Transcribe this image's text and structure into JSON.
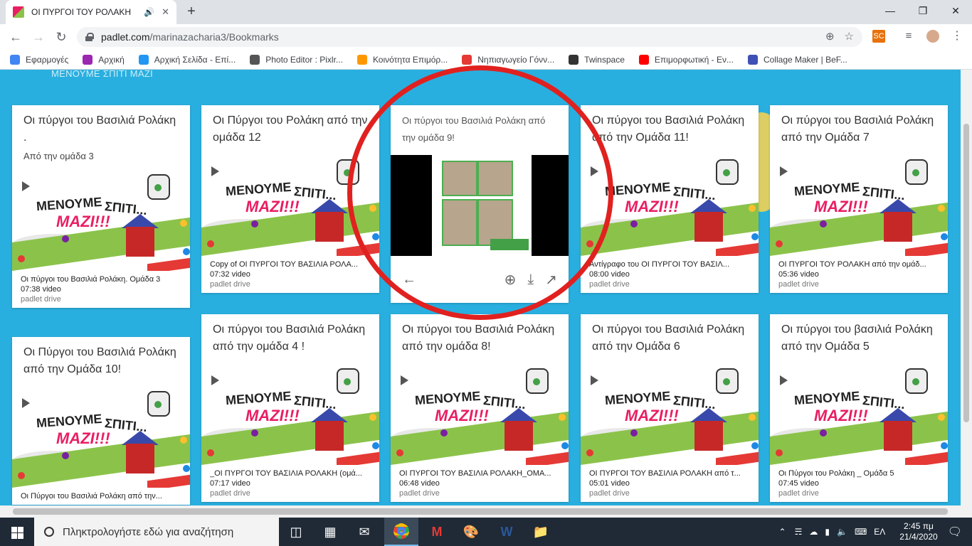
{
  "browser": {
    "tab_title": "ΟΙ ΠΥΡΓΟΙ ΤΟΥ ΡΟΛΑΚΗ",
    "url_domain": "padlet.com",
    "url_path": "/marinazacharia3/Bookmarks",
    "extension_badge": "SC"
  },
  "bookmarks": [
    {
      "label": "Εφαρμογές",
      "icon": "apps-grid-icon",
      "color": "#4285f4"
    },
    {
      "label": "Αρχική",
      "icon": "arrow-icon",
      "color": "#9c27b0"
    },
    {
      "label": "Αρχική Σελίδα - Επί...",
      "icon": "globe-icon",
      "color": "#2196f3"
    },
    {
      "label": "Photo Editor : Pixlr...",
      "icon": "aperture-icon",
      "color": "#555555"
    },
    {
      "label": "Κοινότητα Επιμόρ...",
      "icon": "community-icon",
      "color": "#ff9800"
    },
    {
      "label": "Νηπιαγωγείο Γόνν...",
      "icon": "school-icon",
      "color": "#e53935"
    },
    {
      "label": "Twinspace",
      "icon": "twinspace-icon",
      "color": "#333333"
    },
    {
      "label": "Επιμορφωτική - Εν...",
      "icon": "youtube-icon",
      "color": "#ff0000"
    },
    {
      "label": "Collage Maker | BeF...",
      "icon": "befunky-icon",
      "color": "#3f51b5"
    }
  ],
  "padlet": {
    "header": "ΜΕΝΟΥΜΕ ΣΠΙΤΙ ΜΑΖΙ",
    "thumbnail": {
      "line1": "ΜΕΝΟΥΜΕ",
      "line2": "ΣΠΙΤΙ...",
      "line3": "ΜΑΖΙ!!!"
    },
    "cards": [
      {
        "title": "Οι πύργοι του Βασιλιά Ρολάκη .",
        "body": "Από την ομάδα 3",
        "file": "Οι πύργοι του Βασιλιά Ρολάκη. Ομάδα 3",
        "duration": "07:38 video",
        "source": "padlet drive"
      },
      {
        "title": "Οι Πύργοι του Ρολάκη από την ομάδα 12",
        "body": "",
        "file": "Copy of ΟΙ ΠΥΡΓΟΙ ΤΟΥ ΒΑΣΙΛΙΑ ΡΟΛΑ...",
        "duration": "07:32 video",
        "source": "padlet drive"
      },
      {
        "title": "Οι πύργοι του Βασιλιά Ρολάκη από την ομάδα 9!",
        "body": "",
        "file": "",
        "duration": "",
        "source": ""
      },
      {
        "title": "Οι πύργοι του Βασιλιά Ρολάκη από την Ομάδα 11!",
        "body": "",
        "file": "Αντίγραφο του ΟΙ ΠΥΡΓΟΙ ΤΟΥ ΒΑΣΙΛ...",
        "duration": "08:00 video",
        "source": "padlet drive"
      },
      {
        "title": "Οι πύργοι του Βασιλιά Ρολάκη από την Ομάδα 7",
        "body": "",
        "file": "ΟΙ ΠΥΡΓΟΙ ΤΟΥ ΡΟΛΑΚΗ από την ομάδ...",
        "duration": "05:36 video",
        "source": "padlet drive"
      },
      {
        "title": "Οι Πύργοι του Βασιλιά Ρολάκη από την Ομάδα 10!",
        "body": "",
        "file": "Οι Πύργοι του Βασιλιά Ρολάκη από την...",
        "duration": "",
        "source": ""
      },
      {
        "title": "Οι πύργοι του Βασιλιά Ρολάκη από την ομάδα 4 !",
        "body": "",
        "file": "_ΟΙ ΠΥΡΓΟΙ ΤΟΥ ΒΑΣΙΛΙΑ ΡΟΛΑΚΗ (ομά...",
        "duration": "07:17 video",
        "source": "padlet drive"
      },
      {
        "title": "Οι πύργοι του Βασιλιά Ρολάκη από την ομάδα 8!",
        "body": "",
        "file": "ΟΙ ΠΥΡΓΟΙ ΤΟΥ ΒΑΣΙΛΙΑ ΡΟΛΑΚΗ_ΟΜΑ...",
        "duration": "06:48 video",
        "source": "padlet drive"
      },
      {
        "title": "Οι πύργοι του Βασιλιά Ρολάκη από την Ομάδα 6",
        "body": "",
        "file": "ΟΙ ΠΥΡΓΟΙ ΤΟΥ ΒΑΣΙΛΙΑ ΡΟΛΑΚΗ από τ...",
        "duration": "05:01 video",
        "source": "padlet drive"
      },
      {
        "title": "Οι πύργοι του βασιλιά Ρολάκη από την Ομάδα 5",
        "body": "",
        "file": "Οι Πύργοι του Ρολάκη _ Ομάδα 5",
        "duration": "07:45 video",
        "source": "padlet drive"
      }
    ]
  },
  "taskbar": {
    "search_placeholder": "Πληκτρολογήστε εδώ για αναζήτηση",
    "language": "ΕΛ",
    "time": "2:45 πμ",
    "date": "21/4/2020"
  }
}
